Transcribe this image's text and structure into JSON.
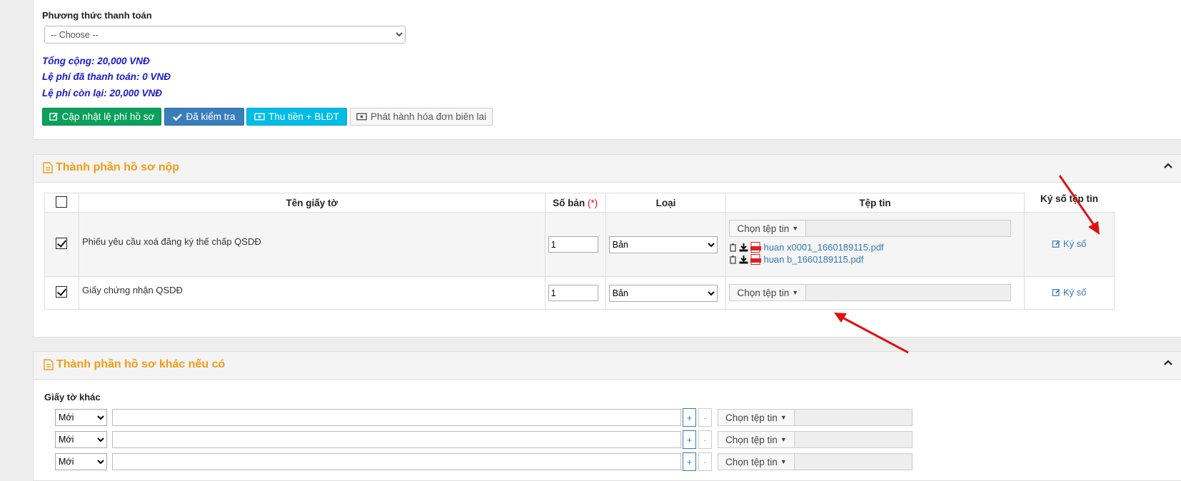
{
  "payment": {
    "method_label": "Phương thức thanh toán",
    "method_selected": "-- Choose --",
    "total": "Tổng cộng: 20,000 VNĐ",
    "paid": "Lệ phí đã thanh toán: 0 VNĐ",
    "remaining": "Lệ phí còn lại: 20,000 VNĐ",
    "buttons": {
      "update_fee": "Cập nhật lệ phí hồ sơ",
      "checked": "Đã kiểm tra",
      "collect": "Thu tiền + BLĐT",
      "invoice": "Phát hành hóa đơn biên lai"
    }
  },
  "submitted_docs": {
    "title": "Thành phần hồ sơ nộp",
    "columns": {
      "name": "Tên giấy tờ",
      "copies": "Số bản",
      "required_mark": "(*)",
      "type": "Loại",
      "file": "Tệp tin",
      "sign": "Ký số tệp tin"
    },
    "rows": [
      {
        "name": "Phiếu yêu cầu xoá đăng ký thế chấp QSDĐ",
        "copies": "1",
        "type": "Bản",
        "files": [
          "huan x0001_1660189115.pdf",
          "huan b_1660189115.pdf"
        ]
      },
      {
        "name": "Giấy chứng nhận QSDĐ",
        "copies": "1",
        "type": "Bản",
        "files": []
      }
    ],
    "choose_file": "Chọn tệp tin",
    "sign_link": "Ký số"
  },
  "other_docs": {
    "title": "Thành phần hồ sơ khác nếu có",
    "label": "Giấy tờ khác",
    "rows": [
      {
        "status": "Mới"
      },
      {
        "status": "Mới"
      },
      {
        "status": "Mới"
      }
    ],
    "choose_file": "Chọn tệp tin",
    "plus": "+",
    "minus": "-"
  },
  "colors": {
    "accent_orange": "#f39c12",
    "fee_blue": "#1a1acc",
    "link_blue": "#337ab7",
    "arrow_red": "#e01010"
  }
}
